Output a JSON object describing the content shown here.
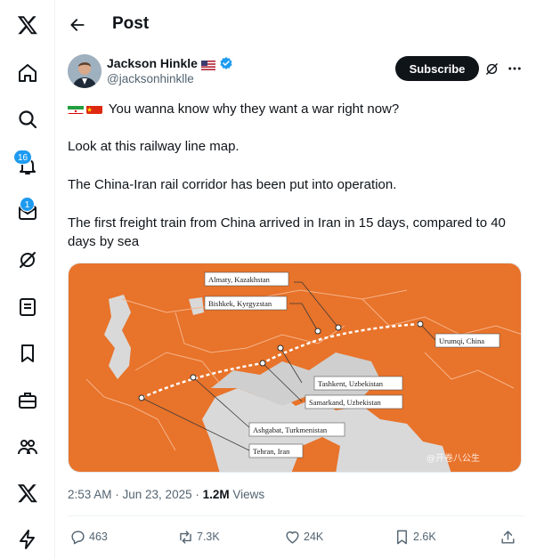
{
  "nav": {
    "items": [
      {
        "name": "x-logo-icon"
      },
      {
        "name": "home-icon"
      },
      {
        "name": "explore-icon"
      },
      {
        "name": "notifications-icon",
        "badge": "16"
      },
      {
        "name": "messages-icon",
        "badge": "1"
      },
      {
        "name": "grok-icon"
      },
      {
        "name": "lists-icon"
      },
      {
        "name": "bookmarks-icon"
      },
      {
        "name": "jobs-icon"
      },
      {
        "name": "communities-icon"
      },
      {
        "name": "premium-icon"
      },
      {
        "name": "verified-orgs-icon"
      }
    ]
  },
  "header": {
    "title": "Post"
  },
  "post": {
    "author_name": "Jackson Hinkle",
    "author_handle": "@jacksonhinklle",
    "subscribe_label": "Subscribe",
    "paragraphs": [
      "You wanna know why they want a war right now?",
      "Look at this railway line map.",
      "The China-Iran rail corridor has been put into operation.",
      "The first freight train from China arrived in Iran in 15 days, compared to 40 days by sea"
    ],
    "timestamp": "2:53 AM · Jun 23, 2025 · ",
    "views_count": "1.2M",
    "views_label": " Views"
  },
  "map": {
    "labels": {
      "almaty": "Almaty, Kazakhstan",
      "bishkek": "Bishkek, Kyrgyzstan",
      "urumqi": "Urumqi, China",
      "tashkent": "Tashkent, Uzbekistan",
      "samarkand": "Samarkand, Uzbekistan",
      "ashgabat": "Ashgabat, Turkmenistan",
      "tehran": "Tehran, Iran"
    },
    "watermark": "@开卷八公生",
    "colors": {
      "land": "#e8732a",
      "water": "#d9d9d9",
      "border": "#f5b38a"
    }
  },
  "actions": {
    "replies": "463",
    "reposts": "7.3K",
    "likes": "24K",
    "bookmarks": "2.6K"
  }
}
